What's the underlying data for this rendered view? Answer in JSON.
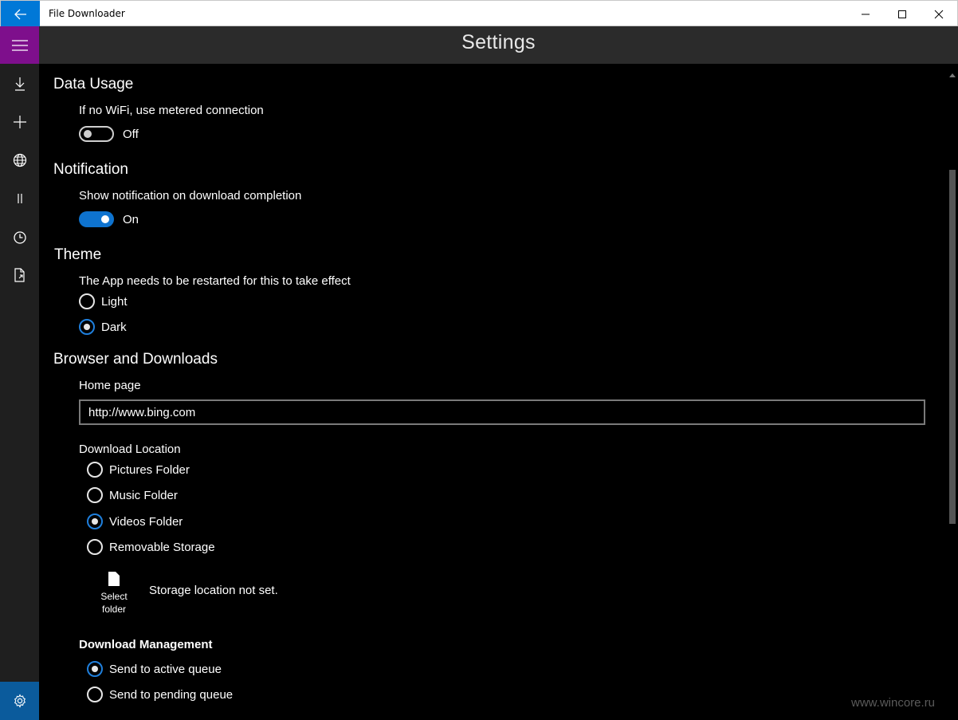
{
  "window": {
    "title": "File Downloader"
  },
  "header": {
    "title": "Settings"
  },
  "data_usage": {
    "title": "Data Usage",
    "metered_label": "If no WiFi, use metered connection",
    "metered_state": "Off"
  },
  "notification": {
    "title": "Notification",
    "completion_label": "Show notification on download completion",
    "completion_state": "On"
  },
  "theme": {
    "title": "Theme",
    "note": "The App needs to be restarted for this to take effect",
    "options": [
      "Light",
      "Dark"
    ],
    "selected": "Dark"
  },
  "browser": {
    "title": "Browser and Downloads",
    "home_page_label": "Home page",
    "home_page_value": "http://www.bing.com",
    "download_location_label": "Download Location",
    "locations": [
      "Pictures Folder",
      "Music Folder",
      "Videos Folder",
      "Removable Storage"
    ],
    "selected_location": "Videos Folder",
    "select_folder_line1": "Select",
    "select_folder_line2": "folder",
    "storage_status": "Storage location not set."
  },
  "download_management": {
    "title": "Download Management",
    "options": [
      "Send to active queue",
      "Send to pending queue"
    ],
    "selected": "Send to active queue"
  },
  "rail": {
    "items": [
      "downloads-icon",
      "add-icon",
      "globe-icon",
      "pause-icon",
      "history-icon",
      "file-export-icon"
    ],
    "settings_icon": "gear-icon"
  },
  "colors": {
    "accent": "#0078d7",
    "hamburger": "#7e0f8c",
    "toggle_on": "#0e73cf"
  },
  "watermark": "www.wincore.ru"
}
